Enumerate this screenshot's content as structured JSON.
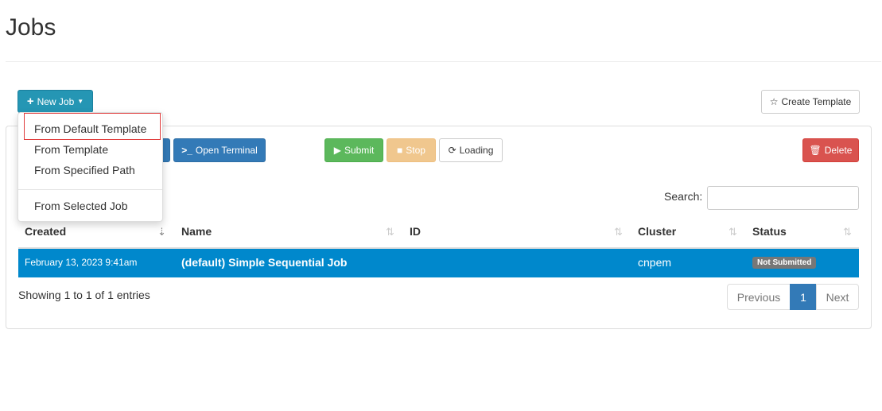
{
  "page": {
    "title": "Jobs"
  },
  "toolbar": {
    "new_job": "New Job",
    "create_template": "Create Template",
    "open_terminal": "Open Terminal",
    "submit": "Submit",
    "stop": "Stop",
    "loading": "Loading",
    "delete": "Delete"
  },
  "menu": {
    "items": [
      "From Default Template",
      "From Template",
      "From Specified Path",
      "From Selected Job"
    ]
  },
  "search": {
    "label": "Search:",
    "value": ""
  },
  "table": {
    "headers": [
      "Created",
      "Name",
      "ID",
      "Cluster",
      "Status"
    ],
    "rows": [
      {
        "created": "February 13, 2023 9:41am",
        "name": "(default) Simple Sequential Job",
        "id": "",
        "cluster": "cnpem",
        "status": "Not Submitted"
      }
    ]
  },
  "footer": {
    "info": "Showing 1 to 1 of 1 entries",
    "previous": "Previous",
    "page": "1",
    "next": "Next"
  },
  "colors": {
    "primary": "#337ab7",
    "info": "#2596b4",
    "success": "#5cb85c",
    "warning": "#f0c78e",
    "danger": "#d9534f",
    "selected_row": "#0088cc"
  }
}
